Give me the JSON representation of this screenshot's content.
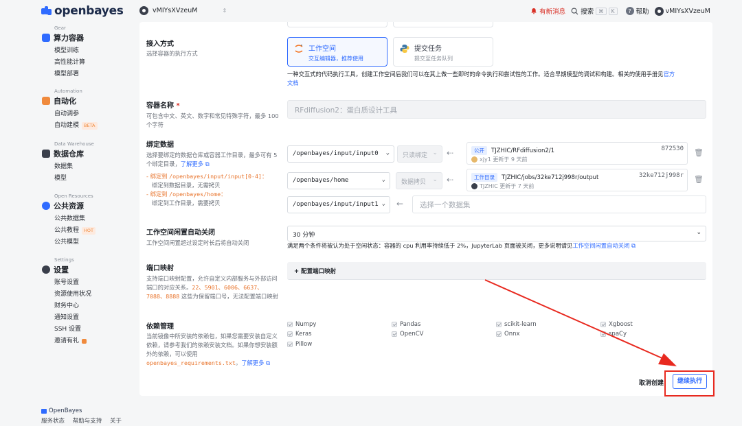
{
  "header": {
    "brand": "openbayes",
    "workspace": "vMIYsXVzeuM",
    "news": "有新消息",
    "search": "搜索",
    "kbd1": "⌘",
    "kbd2": "K",
    "help": "帮助",
    "user": "vMIYsXVzeuM"
  },
  "sidebar": {
    "gear": {
      "en": "Gear",
      "title": "算力容器",
      "items": [
        "模型训练",
        "高性能计算",
        "模型部署"
      ]
    },
    "automation": {
      "en": "Automation",
      "title": "自动化",
      "items": [
        "自动调参",
        "自动建模"
      ],
      "tag": "BETA"
    },
    "warehouse": {
      "en": "Data Warehouse",
      "title": "数据仓库",
      "items": [
        "数据集",
        "模型"
      ]
    },
    "open": {
      "en": "Open Resources",
      "title": "公共资源",
      "items": [
        "公共数据集",
        "公共教程",
        "公共模型"
      ],
      "tag": "HOT"
    },
    "settings": {
      "en": "Settings",
      "title": "设置",
      "items": [
        "账号设置",
        "资源使用状况",
        "财务中心",
        "通知设置",
        "SSH 设置",
        "邀请有礼"
      ]
    }
  },
  "footer": {
    "brand": "OpenBayes",
    "links": [
      "服务状态",
      "帮助与支持",
      "关于"
    ]
  },
  "access": {
    "label": "接入方式",
    "desc": "选择容器的执行方式",
    "workspace_title": "工作空间",
    "workspace_sub": "交互编辑器，推荐使用",
    "job_title": "提交任务",
    "job_sub": "提交至任务队列",
    "note": "一种交互式的代码执行工具，创建工作空间后我们可以在其上做一些即时的命令执行和尝试性的工作。适合早期模型的调试和构建。相关的使用手册见",
    "note_link1": "官方",
    "note_link2": "文档"
  },
  "name": {
    "label": "容器名称",
    "required": "*",
    "desc": "可包含中文、英文、数字和常见特殊字符，最多 100 个字符",
    "value": "RFdiffusion2：蛋白质设计工具"
  },
  "bind": {
    "label": "绑定数据",
    "desc": "选择要绑定的数据仓库或容器工作目录，最多可有 5 个绑定目录，",
    "learn_more": "了解更多",
    "rule1_prefix": "绑定到 ",
    "rule1_path": "/openbayes/input/input[0-4]",
    "rule1_suffix": "：",
    "rule1_desc": "绑定到数据目录，无需拷贝",
    "rule2_prefix": "绑定到 ",
    "rule2_path": "/openbayes/home",
    "rule2_suffix": "：",
    "rule2_desc": "绑定到工作目录，需要拷贝",
    "rows": [
      {
        "path": "/openbayes/input/input0",
        "mode": "只读绑定",
        "badge": "公开",
        "name": "TJZHIC/RFdiffusion2/1",
        "meta": "xjy1 更新于 9 天前",
        "id": "872530"
      },
      {
        "path": "/openbayes/home",
        "mode": "数据拷贝",
        "badge": "工作目录",
        "name": "TJZHIC/jobs/32ke712j998r/output",
        "meta": "TJZHIC 更新于 7 天前",
        "id": "32ke712j998r"
      }
    ],
    "empty_path": "/openbayes/input/input1",
    "empty_placeholder": "选择一个数据集"
  },
  "idle": {
    "label": "工作空间闲置自动关闭",
    "desc": "工作空间闲置超过设定时长后将自动关闭",
    "value": "30 分钟",
    "note": "满足两个条件将被认为处于空闲状态：容器的 cpu 利用率持续低于 2%，JupyterLab 页面被关闭，更多说明请见",
    "note_link": "工作空间闲置自动关闭"
  },
  "ports": {
    "label": "端口映射",
    "desc_pre": "支持端口映射配置，允许自定义内部服务与外部访问端口的对应关系。",
    "ports": "22、5901、6006、6637、7088、8888",
    "desc_post": " 这些为保留端口号，无法配置端口映射",
    "button": "+ 配置端口映射"
  },
  "deps": {
    "label": "依赖管理",
    "desc": "当前镜像中所安装的依赖包，如果您需要安装自定义依赖，请参考我们的依赖安装文档。如果你想安装额外的依赖，可以使用",
    "file": "openbayes_requirements.txt",
    "learn_more": "了解更多",
    "items": [
      "Numpy",
      "Pandas",
      "scikit-learn",
      "Xgboost",
      "Keras",
      "OpenCV",
      "Onnx",
      "spaCy",
      "Pillow"
    ]
  },
  "actions": {
    "cancel": "取消创建",
    "submit": "继续执行"
  },
  "colors": {
    "primary": "#2f6bff",
    "annotation": "#e8291f",
    "warning": "#e8742c"
  }
}
